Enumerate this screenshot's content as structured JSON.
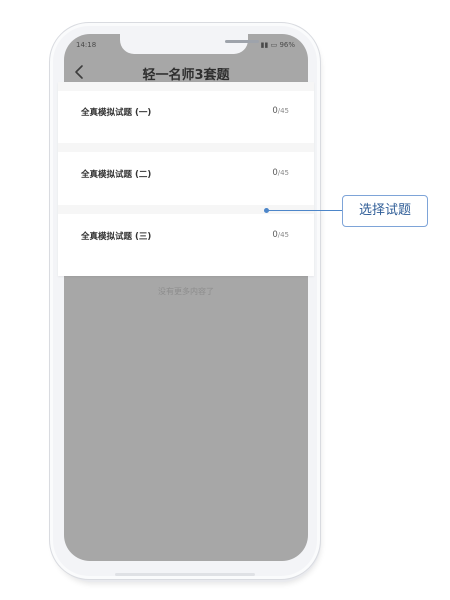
{
  "status_bar": {
    "time": "14:18",
    "battery": "96%"
  },
  "header": {
    "title": "轻一名师3套题"
  },
  "exam_sets": [
    {
      "name": "全真模拟试题 (一)",
      "done": "0",
      "total": "/45"
    },
    {
      "name": "全真模拟试题 (二)",
      "done": "0",
      "total": "/45"
    },
    {
      "name": "全真模拟试题 (三)",
      "done": "0",
      "total": "/45"
    }
  ],
  "empty_state": {
    "text": "没有更多内容了"
  },
  "callout": {
    "label": "选择试题"
  },
  "colors": {
    "accent": "#4d86c9",
    "screen_overlay": "#a7a7a7"
  }
}
